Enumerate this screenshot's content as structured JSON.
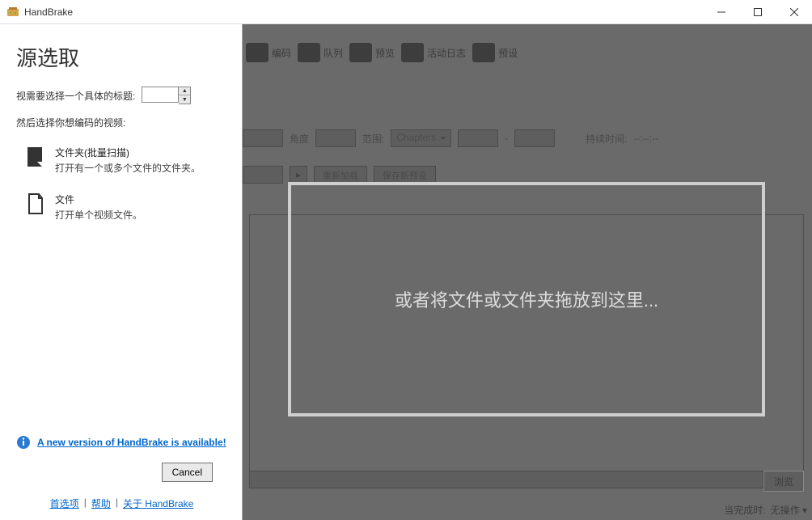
{
  "window": {
    "title": "HandBrake"
  },
  "toolbar": {
    "encode": "编码",
    "queue": "队列",
    "preview": "预览",
    "activity": "活动日志",
    "presets": "预设"
  },
  "bg": {
    "angle": "角度",
    "range": "范围:",
    "chapters": "Chapters",
    "dash": "-",
    "duration_label": "持续时间:",
    "duration_value": "--:--:--",
    "reload": "重新加载",
    "save_preset": "保存新预设",
    "browse": "浏览",
    "status_label": "当完成时:",
    "status_value": "无操作"
  },
  "drop": {
    "message": "或者将文件或文件夹拖放到这里..."
  },
  "side": {
    "title": "源选取",
    "title_label": "视需要选择一个具体的标题:",
    "subtitle": "然后选择你想编码的视频:",
    "folder_title": "文件夹(批量扫描)",
    "folder_sub": "打开有一个或多个文件的文件夹。",
    "file_title": "文件",
    "file_sub": "打开单个视频文件。",
    "update_text": "A new version of HandBrake is available!",
    "cancel": "Cancel",
    "link_prefs": "首选项",
    "link_help": "帮助",
    "link_about": "关于 HandBrake"
  }
}
